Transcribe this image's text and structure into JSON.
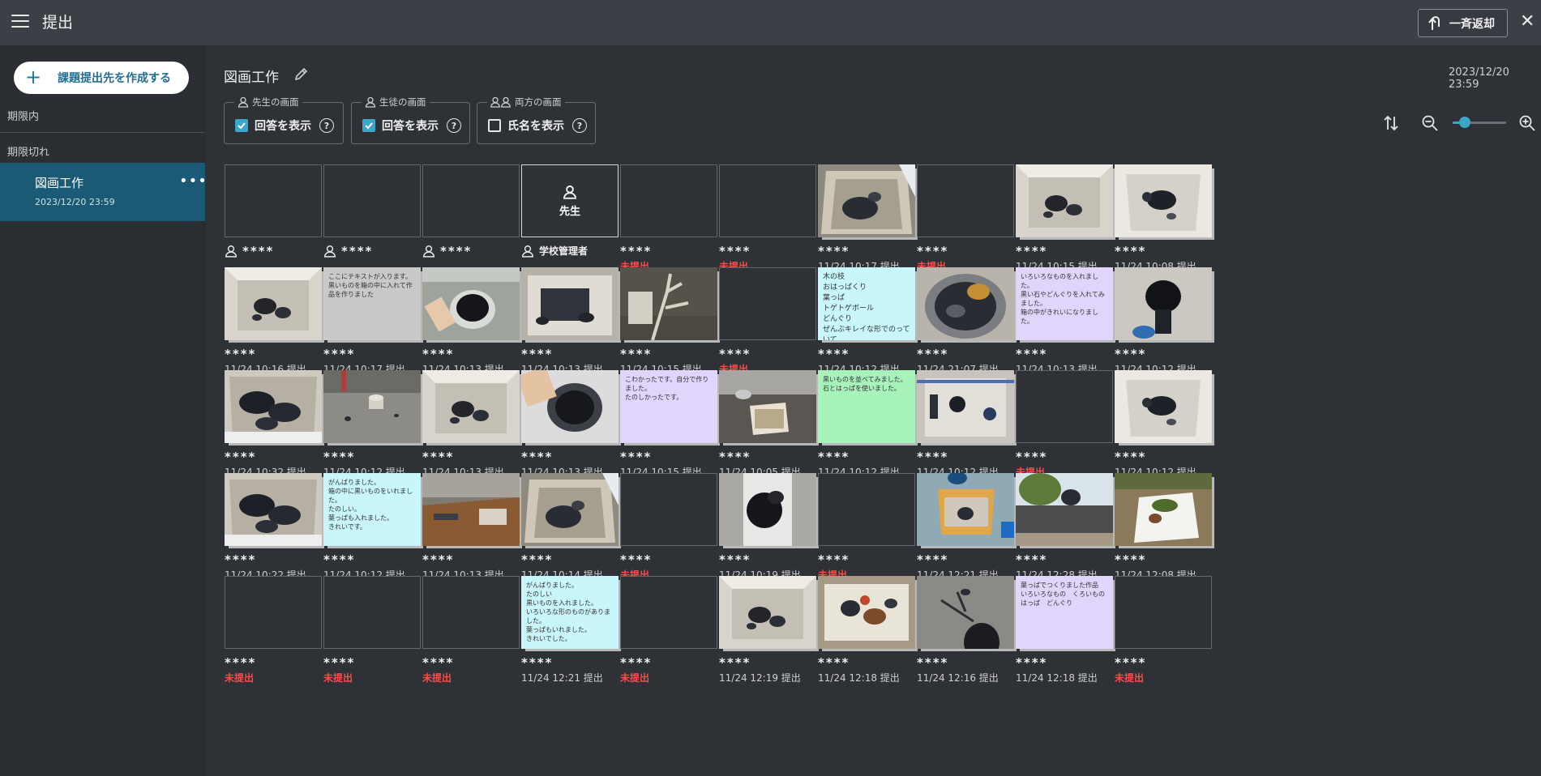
{
  "header": {
    "title": "提出",
    "return_all_label": "一斉返却"
  },
  "sidebar": {
    "create_label": "課題提出先を作成する",
    "section_active": "期限内",
    "section_expired": "期限切れ",
    "item": {
      "name": "図画工作",
      "date": "2023/12/20 23:59"
    }
  },
  "main": {
    "title": "図画工作",
    "deadline": "2023/12/20 23:59",
    "options": [
      {
        "legend": "先生の画面",
        "label": "回答を表示",
        "checked": true
      },
      {
        "legend": "生徒の画面",
        "label": "回答を表示",
        "checked": true
      },
      {
        "legend": "両方の画面",
        "label": "氏名を表示",
        "checked": false
      }
    ],
    "help_glyph": "?",
    "zoom_level": 0.22
  },
  "colors": {
    "accent": "#3aa6c9",
    "missing": "#ff4a4a",
    "selected_sidebar": "#1b5a74"
  },
  "grid": {
    "rows": [
      [
        {
          "name": "****",
          "user_icon": true,
          "kind": "empty",
          "status": ""
        },
        {
          "name": "****",
          "user_icon": true,
          "kind": "empty",
          "status": ""
        },
        {
          "name": "****",
          "user_icon": true,
          "kind": "empty",
          "status": ""
        },
        {
          "name": "学校管理者",
          "user_icon": true,
          "kind": "teacher",
          "label": "先生",
          "status": ""
        },
        {
          "name": "****",
          "kind": "empty",
          "status": "未提出",
          "missing": true
        },
        {
          "name": "****",
          "kind": "empty",
          "status": "未提出",
          "missing": true
        },
        {
          "name": "****",
          "kind": "photo",
          "photo": "box-gray",
          "stack": true,
          "status": "11/24 10:17 提出"
        },
        {
          "name": "****",
          "kind": "empty",
          "status": "未提出",
          "missing": true
        },
        {
          "name": "****",
          "kind": "photo",
          "photo": "box-white",
          "stack": true,
          "status": "11/24 10:15 提出"
        },
        {
          "name": "****",
          "kind": "photo",
          "photo": "box-white2",
          "stack": true,
          "status": "11/24 10:08 提出"
        }
      ],
      [
        {
          "name": "****",
          "kind": "photo",
          "photo": "box-white",
          "stack": true,
          "status": "11/24 10:16 提出"
        },
        {
          "name": "****",
          "kind": "text",
          "color": "grey",
          "stack": true,
          "text": "ここにテキストが入ります。\n黒いものを箱の中に入れて作品を作りました",
          "status": "11/24 10:17 提出"
        },
        {
          "name": "****",
          "kind": "photo",
          "photo": "can-hand",
          "stack": true,
          "status": "11/24 10:13 提出"
        },
        {
          "name": "****",
          "kind": "photo",
          "photo": "box-dark",
          "stack": true,
          "status": "11/24 10:13 提出"
        },
        {
          "name": "****",
          "kind": "photo",
          "photo": "tree",
          "stack": true,
          "status": "11/24 10:15 提出"
        },
        {
          "name": "****",
          "kind": "empty",
          "status": "未提出",
          "missing": true
        },
        {
          "name": "****",
          "kind": "text",
          "color": "cyan",
          "stack": true,
          "big": true,
          "text": "木の枝\nおはっぱくり\n葉っぱ\nトゲトゲボール\nどんぐり\nぜんぶキレイな形でのっていて\nすごった",
          "status": "11/24 10:12 提出"
        },
        {
          "name": "****",
          "kind": "photo",
          "photo": "pot",
          "stack": true,
          "status": "11/24 21:07 提出"
        },
        {
          "name": "****",
          "kind": "text",
          "color": "lav",
          "stack": true,
          "text": "いろいろなものを入れました。\n黒い石やどんぐりを入れてみました。\n箱の中がきれいになりました。",
          "status": "11/24 10:13 提出"
        },
        {
          "name": "****",
          "kind": "photo",
          "photo": "ball",
          "stack": true,
          "status": "11/24 10:12 提出"
        }
      ],
      [
        {
          "name": "****",
          "kind": "photo",
          "photo": "box-mess",
          "stack": true,
          "status": "11/24 10:32 提出"
        },
        {
          "name": "****",
          "kind": "photo",
          "photo": "ground",
          "stack": true,
          "status": "11/24 10:12 提出"
        },
        {
          "name": "****",
          "kind": "photo",
          "photo": "box-white",
          "stack": true,
          "status": "11/24 10:13 提出"
        },
        {
          "name": "****",
          "kind": "photo",
          "photo": "bowl",
          "stack": true,
          "status": "11/24 10:13 提出"
        },
        {
          "name": "****",
          "kind": "text",
          "color": "lav",
          "stack": true,
          "text": "こわかったです。自分で作りました。\nたのしかったです。",
          "status": "11/24 10:15 提出"
        },
        {
          "name": "****",
          "kind": "photo",
          "photo": "box-ground",
          "stack": true,
          "status": "11/24 10:05 提出"
        },
        {
          "name": "****",
          "kind": "text",
          "color": "green",
          "stack": true,
          "text": "黒いものを並べてみました。\n石とはっぱを使いました。",
          "status": "11/24 10:12 提出"
        },
        {
          "name": "****",
          "kind": "photo",
          "photo": "box-blue",
          "stack": true,
          "status": "11/24 10:12 提出"
        },
        {
          "name": "****",
          "kind": "empty",
          "status": "未提出",
          "missing": true
        },
        {
          "name": "****",
          "kind": "photo",
          "photo": "box-white2",
          "stack": true,
          "status": "11/24 10:12 提出"
        }
      ],
      [
        {
          "name": "****",
          "kind": "photo",
          "photo": "box-mess",
          "stack": true,
          "status": "11/24 10:22 提出"
        },
        {
          "name": "****",
          "kind": "text",
          "color": "cyan",
          "stack": true,
          "text": "がんばりました。\n箱の中に黒いものをいれました。\nたのしい。\n葉っぱも入れました。\nきれいです。",
          "status": "11/24 10:12 提出"
        },
        {
          "name": "****",
          "kind": "photo",
          "photo": "desk",
          "stack": true,
          "status": "11/24 10:13 提出"
        },
        {
          "name": "****",
          "kind": "photo",
          "photo": "box-gray",
          "stack": true,
          "status": "11/24 10:14 提出"
        },
        {
          "name": "****",
          "kind": "empty",
          "status": "未提出",
          "missing": true
        },
        {
          "name": "****",
          "kind": "photo",
          "photo": "hand-dark",
          "stack": true,
          "status": "11/24 10:19 提出"
        },
        {
          "name": "****",
          "kind": "empty",
          "status": "未提出",
          "missing": true
        },
        {
          "name": "****",
          "kind": "photo",
          "photo": "box-orange",
          "stack": true,
          "status": "11/24 12:21 提出"
        },
        {
          "name": "****",
          "kind": "photo",
          "photo": "outdoor",
          "stack": true,
          "status": "11/24 12:28 提出"
        },
        {
          "name": "****",
          "kind": "photo",
          "photo": "bag",
          "stack": true,
          "status": "11/24 12:08 提出"
        }
      ],
      [
        {
          "name": "****",
          "kind": "empty",
          "status": "未提出",
          "missing": true
        },
        {
          "name": "****",
          "kind": "empty",
          "status": "未提出",
          "missing": true
        },
        {
          "name": "****",
          "kind": "empty",
          "status": "未提出",
          "missing": true
        },
        {
          "name": "****",
          "kind": "text",
          "color": "cyan",
          "stack": true,
          "text": "がんばりました。\nたのしい\n黒いものを入れました。\nいろいろな形のものがありました。\n葉っぱもいれました。\nきれいでした。",
          "status": "11/24 12:21 提出"
        },
        {
          "name": "****",
          "kind": "empty",
          "status": "未提出",
          "missing": true
        },
        {
          "name": "****",
          "kind": "photo",
          "photo": "box-white",
          "stack": true,
          "status": "11/24 12:19 提出"
        },
        {
          "name": "****",
          "kind": "photo",
          "photo": "tray",
          "stack": true,
          "status": "11/24 12:18 提出"
        },
        {
          "name": "****",
          "kind": "photo",
          "photo": "shadow",
          "stack": true,
          "status": "11/24 12:16 提出"
        },
        {
          "name": "****",
          "kind": "text",
          "color": "lav",
          "stack": true,
          "text": "葉っぱでつくりました作品\nいろいろなもの　くろいもの\nはっぱ　どんぐり",
          "status": "11/24 12:18 提出"
        },
        {
          "name": "****",
          "kind": "empty",
          "status": "未提出",
          "missing": true
        }
      ]
    ]
  }
}
